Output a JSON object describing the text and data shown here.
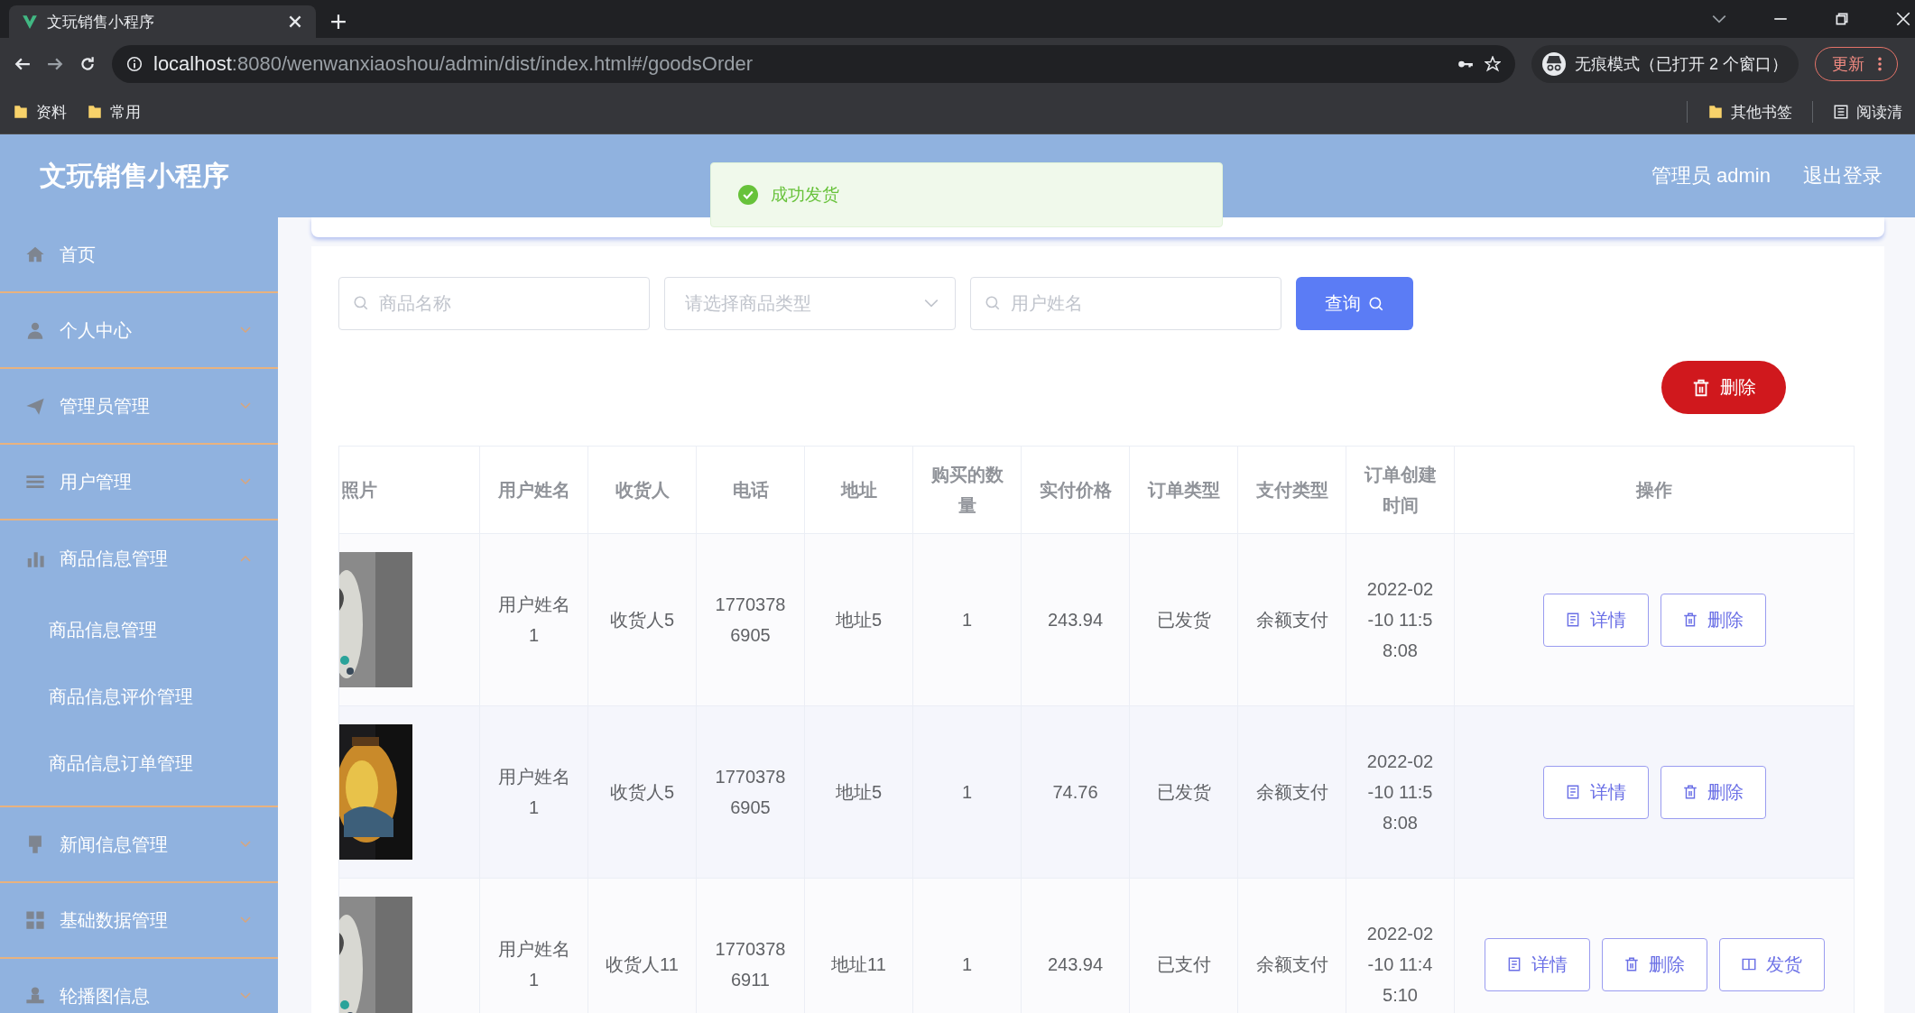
{
  "browser": {
    "tab_title": "文玩销售小程序",
    "url_host": "localhost",
    "url_path": ":8080/wenwanxiaoshou/admin/dist/index.html#/goodsOrder",
    "incognito_label": "无痕模式（已打开 2 个窗口）",
    "update_button": "更新",
    "bookmarks": [
      "资料",
      "常用"
    ],
    "other_bookmarks": "其他书签",
    "reading_list": "阅读清"
  },
  "header": {
    "title": "文玩销售小程序",
    "user": "管理员 admin",
    "logout": "退出登录"
  },
  "toast": {
    "kind": "success",
    "message": "成功发货"
  },
  "sidebar": {
    "items": [
      {
        "label": "首页"
      },
      {
        "label": "个人中心",
        "expanded": false
      },
      {
        "label": "管理员管理",
        "expanded": false
      },
      {
        "label": "用户管理",
        "expanded": false
      },
      {
        "label": "商品信息管理",
        "expanded": true,
        "children": [
          {
            "label": "商品信息管理"
          },
          {
            "label": "商品信息评价管理"
          },
          {
            "label": "商品信息订单管理"
          }
        ]
      },
      {
        "label": "新闻信息管理",
        "expanded": false
      },
      {
        "label": "基础数据管理",
        "expanded": false
      },
      {
        "label": "轮播图信息",
        "expanded": false
      }
    ]
  },
  "filters": {
    "fields": [
      {
        "kind": "search",
        "placeholder": "商品名称"
      },
      {
        "kind": "select",
        "placeholder": "请选择商品类型"
      },
      {
        "kind": "search",
        "placeholder": "用户姓名"
      }
    ],
    "query_button": "查询"
  },
  "delete_button": "删除",
  "table": {
    "columns": [
      "照片",
      "用户姓名",
      "收货人",
      "电话",
      "地址",
      "购买的数量",
      "实付价格",
      "订单类型",
      "支付类型",
      "订单创建时间",
      "操作"
    ],
    "rows": [
      {
        "cells": [
          {
            "kind": "picture"
          },
          "用户姓名1",
          "收货人5",
          "17703786905",
          "地址5",
          "1",
          "243.94",
          "已发货",
          "余额支付",
          "2022-02-10 11:58:08"
        ],
        "actions": [
          {
            "kind": "detail",
            "label": "详情"
          },
          {
            "kind": "delete",
            "label": "删除"
          }
        ]
      },
      {
        "cells": [
          {
            "kind": "picture"
          },
          "用户姓名1",
          "收货人5",
          "17703786905",
          "地址5",
          "1",
          "74.76",
          "已发货",
          "余额支付",
          "2022-02-10 11:58:08"
        ],
        "actions": [
          {
            "kind": "detail",
            "label": "详情"
          },
          {
            "kind": "delete",
            "label": "删除"
          }
        ]
      },
      {
        "cells": [
          {
            "kind": "picture"
          },
          "用户姓名1",
          "收货人11",
          "17703786911",
          "地址11",
          "1",
          "243.94",
          "已支付",
          "余额支付",
          "2022-02-10 11:45:10"
        ],
        "actions": [
          {
            "kind": "detail",
            "label": "详情"
          },
          {
            "kind": "delete",
            "label": "删除"
          },
          {
            "kind": "ship",
            "label": "发货"
          }
        ]
      }
    ]
  }
}
